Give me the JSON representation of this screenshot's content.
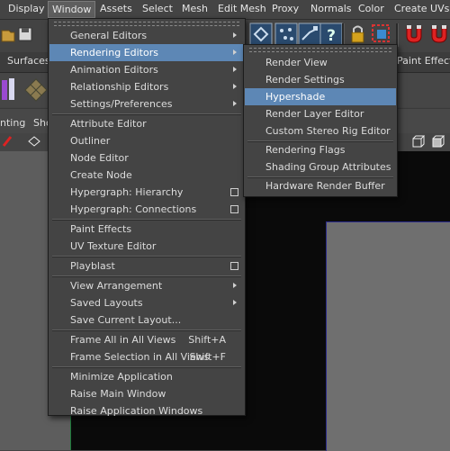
{
  "menubar": {
    "items": [
      "Display",
      "Window",
      "Assets",
      "Select",
      "Mesh",
      "Edit Mesh",
      "Proxy",
      "Normals",
      "Color",
      "Create UVs"
    ]
  },
  "shelf": {
    "tabs": [
      "Surfaces",
      "Paint Effects"
    ]
  },
  "panel": {
    "left_labels": [
      "nting",
      "Sho"
    ]
  },
  "window_menu": {
    "groups": [
      [
        {
          "label": "General Editors",
          "type": "submenu"
        },
        {
          "label": "Rendering Editors",
          "type": "submenu",
          "highlighted": true
        },
        {
          "label": "Animation Editors",
          "type": "submenu"
        },
        {
          "label": "Relationship Editors",
          "type": "submenu"
        },
        {
          "label": "Settings/Preferences",
          "type": "submenu"
        }
      ],
      [
        {
          "label": "Attribute Editor"
        },
        {
          "label": "Outliner"
        },
        {
          "label": "Node Editor"
        },
        {
          "label": "Create Node"
        },
        {
          "label": "Hypergraph: Hierarchy",
          "type": "option"
        },
        {
          "label": "Hypergraph: Connections",
          "type": "option"
        }
      ],
      [
        {
          "label": "Paint Effects"
        },
        {
          "label": "UV Texture Editor"
        }
      ],
      [
        {
          "label": "Playblast",
          "type": "option"
        }
      ],
      [
        {
          "label": "View Arrangement",
          "type": "submenu"
        },
        {
          "label": "Saved Layouts",
          "type": "submenu"
        },
        {
          "label": "Save Current Layout..."
        }
      ],
      [
        {
          "label": "Frame All in All Views",
          "shortcut": "Shift+A"
        },
        {
          "label": "Frame Selection in All Views",
          "shortcut": "Shift+F"
        }
      ],
      [
        {
          "label": "Minimize Application"
        },
        {
          "label": "Raise Main Window"
        },
        {
          "label": "Raise Application Windows"
        }
      ]
    ]
  },
  "rendering_submenu": {
    "groups": [
      [
        {
          "label": "Render View"
        },
        {
          "label": "Render Settings"
        },
        {
          "label": "Hypershade",
          "highlighted": true
        },
        {
          "label": "Render Layer Editor"
        },
        {
          "label": "Custom Stereo Rig Editor"
        }
      ],
      [
        {
          "label": "Rendering Flags"
        },
        {
          "label": "Shading Group Attributes"
        }
      ],
      [
        {
          "label": "Hardware Render Buffer"
        }
      ]
    ]
  },
  "colors": {
    "highlight": "#5d87b5",
    "menu_bg": "#444444",
    "viewport_bg": "#0a0a0a"
  }
}
